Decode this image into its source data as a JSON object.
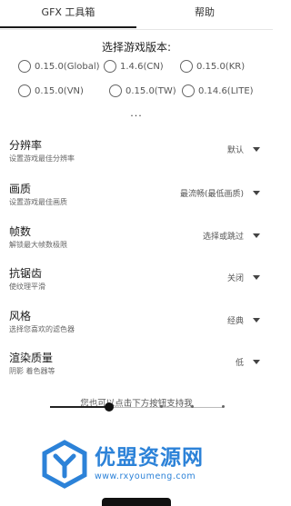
{
  "tabs": [
    {
      "label": "GFX 工具箱",
      "active": true
    },
    {
      "label": "帮助",
      "active": false
    }
  ],
  "version_section": {
    "title": "选择游戏版本:",
    "options": [
      {
        "label": "0.15.0(Global)",
        "selected": false
      },
      {
        "label": "1.4.6(CN)",
        "selected": false
      },
      {
        "label": "0.15.0(KR)",
        "selected": false
      },
      {
        "label": "0.15.0(VN)",
        "selected": false
      },
      {
        "label": "0.15.0(TW)",
        "selected": false
      },
      {
        "label": "0.14.6(LITE)",
        "selected": false
      }
    ],
    "more": "..."
  },
  "settings": [
    {
      "title": "分辨率",
      "description": "设置游戏最佳分辨率",
      "value": "默认"
    },
    {
      "title": "画质",
      "description": "设置游戏最佳画质",
      "value": "最流畅(最低画质)"
    },
    {
      "title": "帧数",
      "description": "解锁最大帧数极限",
      "value": "选择或跳过"
    },
    {
      "title": "抗锯齿",
      "description": "使纹理平滑",
      "value": "关闭"
    },
    {
      "title": "风格",
      "description": "选择您喜欢的滤色器",
      "value": "经典"
    },
    {
      "title": "渲染质量",
      "description": "阴影 着色器等",
      "value": "低"
    }
  ],
  "support_text": "您也可以点击下方按钮支持我",
  "slider": {
    "value_fraction": 0.34,
    "tick_fractions": [
      0.64,
      0.82,
      1.0
    ]
  },
  "watermark": {
    "text": "优盟资源网",
    "url": "www.rxyoumeng.com"
  },
  "colors": {
    "accent": "#1a1a1a",
    "watermark": "#2c82d8"
  },
  "icons": {
    "dropdown": "triangle-down-icon",
    "radio": "radio-empty-icon",
    "logo": "y-logo-icon"
  }
}
